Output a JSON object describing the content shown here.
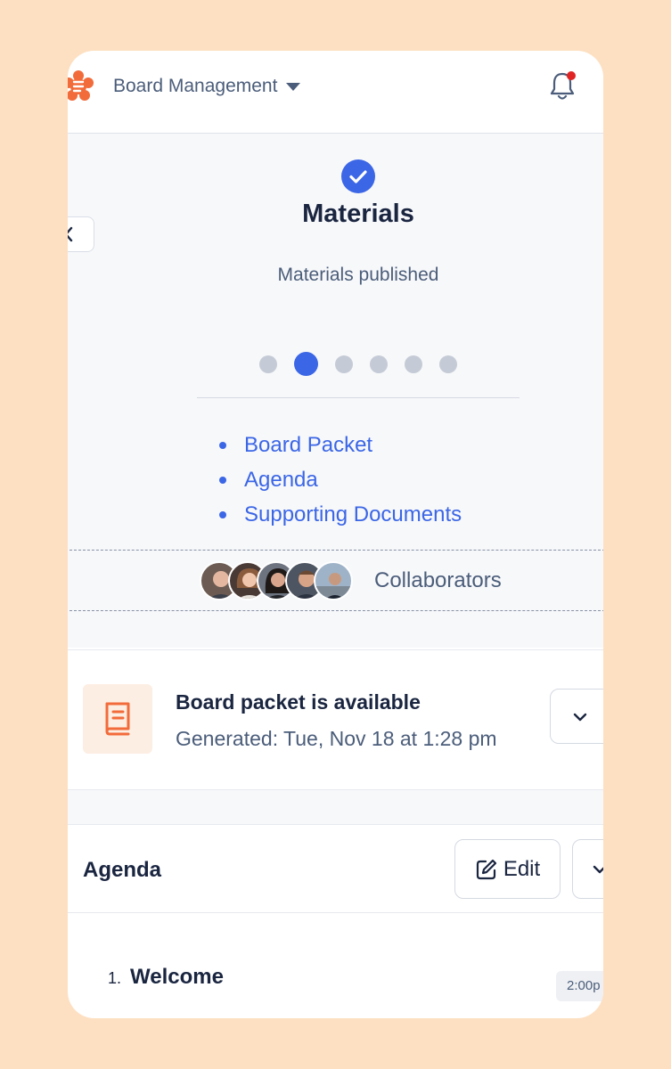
{
  "header": {
    "workspace": "Board Management"
  },
  "hero": {
    "title": "Materials",
    "subtitle": "Materials published",
    "step_count": 6,
    "active_step": 2,
    "links": [
      "Board Packet",
      "Agenda",
      "Supporting Documents"
    ],
    "collaborators_label": "Collaborators"
  },
  "packet": {
    "title": "Board packet is available",
    "generated": "Generated: Tue, Nov 18 at 1:28 pm"
  },
  "agenda": {
    "title": "Agenda",
    "edit_label": "Edit",
    "items": [
      {
        "number": "1.",
        "title": "Welcome",
        "time": "2:00p"
      }
    ]
  },
  "colors": {
    "accent": "#3b66e6",
    "brand_orange": "#f26b3a",
    "notification": "#e02424",
    "background": "#fde0c2"
  },
  "icons": {
    "logo": "brand-logo-icon",
    "bell": "bell-icon",
    "check": "check-circle-icon",
    "back": "chevron-left-icon",
    "packet": "book-icon",
    "edit": "pencil-square-icon",
    "expand": "chevron-down-icon"
  }
}
